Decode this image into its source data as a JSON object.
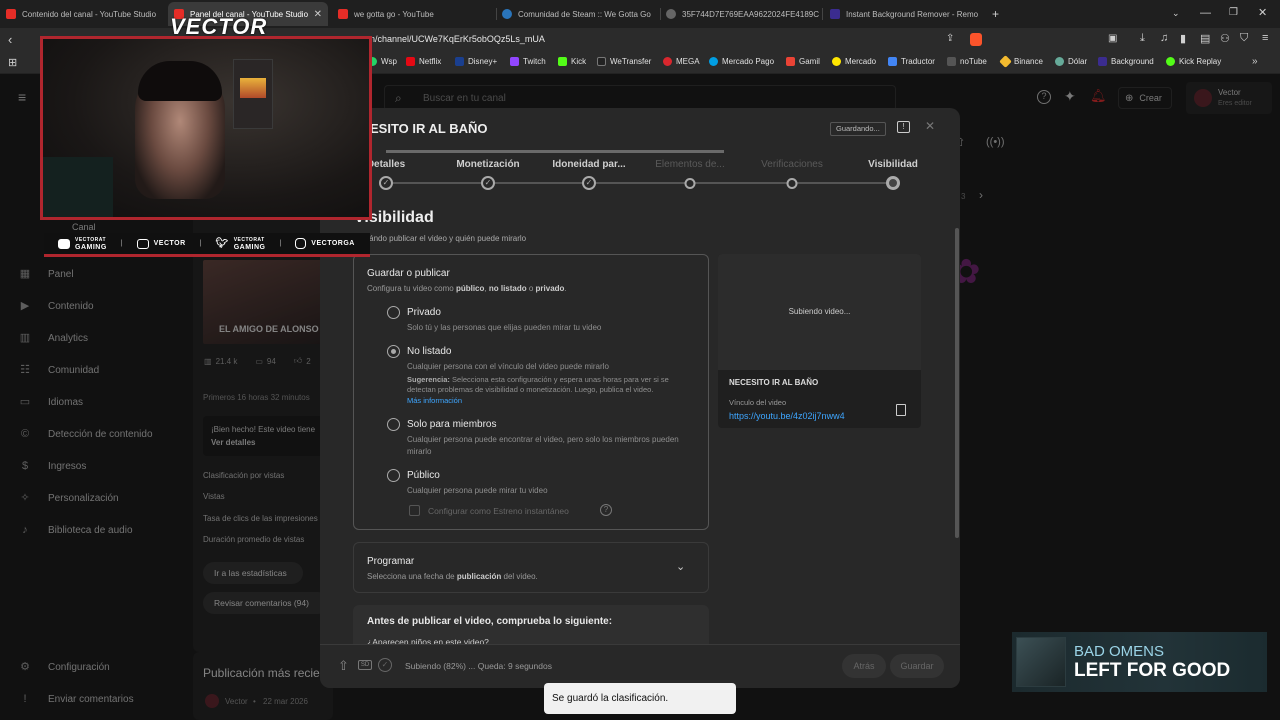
{
  "tabs": [
    {
      "label": "Contenido del canal - YouTube Studio",
      "active": false
    },
    {
      "label": "Panel del canal - YouTube Studio",
      "active": true
    },
    {
      "label": "we gotta go - YouTube",
      "active": false
    },
    {
      "label": "Comunidad de Steam :: We Gotta Go",
      "active": false
    },
    {
      "label": "35F744D7E769EAA9622024FE4189C",
      "active": false
    },
    {
      "label": "Instant Background Remover - Remo",
      "active": false
    }
  ],
  "address": {
    "url": "n/channel/UCWe7KqErKr5obOQz5Ls_mUA"
  },
  "bookmarks": [
    "Wsp",
    "Netflix",
    "Disney+",
    "Twitch",
    "Kick",
    "WeTransfer",
    "MEGA",
    "Mercado Pago",
    "Gamil",
    "Mercado",
    "Traductor",
    "noTube",
    "Binance",
    "Dólar",
    "Background",
    "Kick Replay"
  ],
  "studio": {
    "search_placeholder": "Buscar en tu canal",
    "create_label": "Crear",
    "account_name": "Vector",
    "account_role": "Eres editor",
    "channel_label": "Canal",
    "nav": [
      "Panel",
      "Contenido",
      "Analytics",
      "Comunidad",
      "Idiomas",
      "Detección de contenido",
      "Ingresos",
      "Personalización",
      "Biblioteca de audio"
    ],
    "nav_bottom": [
      "Configuración",
      "Enviar comentarios"
    ],
    "video_title": "EL AMIGO DE ALONSO",
    "views": "21.4 k",
    "comments": "94",
    "likes": "2",
    "first_hours": "Primeros 16 horas 32 minutos",
    "notice_line1": "¡Bien hecho! Este video tiene",
    "notice_line2": "Ver detalles",
    "stats": [
      "Clasificación por vistas",
      "Vistas",
      "Tasa de clics de las impresiones",
      "Duración promedio de vistas"
    ],
    "btn_stats": "Ir a las estadísticas",
    "btn_comments": "Revisar comentarios (94)",
    "latest_post": "Publicación más recie",
    "latest_author": "Vector",
    "latest_date": "22 mar 2026",
    "pager": "3"
  },
  "modal": {
    "title": "ESITO IR AL BAÑO",
    "saving_badge": "Guardando...",
    "steps": [
      "Detalles",
      "Monetización",
      "Idoneidad par...",
      "Elementos de...",
      "Verificaciones",
      "Visibilidad"
    ],
    "heading": "Visibilidad",
    "subheading": "e cuándo publicar el video y quién puede mirarlo",
    "save_title": "Guardar o publicar",
    "save_desc_pre": "Configura tu video como ",
    "save_desc_b1": "público",
    "save_desc_sep1": ", ",
    "save_desc_b2": "no listado",
    "save_desc_sep2": " o ",
    "save_desc_b3": "privado",
    "save_desc_end": ".",
    "options": [
      {
        "title": "Privado",
        "desc": "Solo tú y las personas que elijas pueden mirar tu video",
        "selected": false
      },
      {
        "title": "No listado",
        "desc": "Cualquier persona con el vínculo del video puede mirarlo",
        "selected": true
      },
      {
        "title": "Solo para miembros",
        "desc": "Cualquier persona puede encontrar el video, pero solo los miembros pueden mirarlo",
        "selected": false
      },
      {
        "title": "Público",
        "desc": "Cualquier persona puede mirar tu video",
        "selected": false
      }
    ],
    "suggestion_label": "Sugerencia:",
    "suggestion_text": "Selecciona esta configuración y espera unas horas para ver si se detectan problemas de visibilidad o monetización. Luego, publica el video.",
    "more_info": "Más información",
    "premiere_label": "Configurar como Estreno instantáneo",
    "schedule_title": "Programar",
    "schedule_desc_pre": "Selecciona una fecha de ",
    "schedule_desc_b": "publicación",
    "schedule_desc_end": " del video.",
    "checklist_title": "Antes de publicar el video, comprueba lo siguiente:",
    "checklist_item": "¿Aparecen niños en este video?",
    "preview_status": "Subiendo video...",
    "preview_title": "NECESITO IR AL BAÑO",
    "link_label": "Vínculo del video",
    "link_url": "https://youtu.be/4z02ij7nww4",
    "upload_status": "Subiendo (82%) ... Queda: 9 segundos",
    "btn_back": "Atrás",
    "btn_save": "Guardar",
    "hd_badge": "SD"
  },
  "overlay": {
    "logo": "VECTOR",
    "socials": [
      {
        "icon": "youtube-icon",
        "top": "VECTORAT",
        "bottom": "GAMING"
      },
      {
        "icon": "twitch-icon",
        "top": "",
        "bottom": "VECTOR"
      },
      {
        "icon": "twitter-icon",
        "top": "VECTORAT",
        "bottom": "GAMING"
      },
      {
        "icon": "instagram-icon",
        "top": "",
        "bottom": "VECTORGA"
      }
    ]
  },
  "toast": "Se guardó la clasificación.",
  "now_playing": {
    "artist": "BAD OMENS",
    "song": "LEFT FOR GOOD"
  },
  "colors": {
    "accent_red": "#b0262e",
    "link_blue": "#3ea6ff",
    "bg": "#1f1f1f"
  }
}
